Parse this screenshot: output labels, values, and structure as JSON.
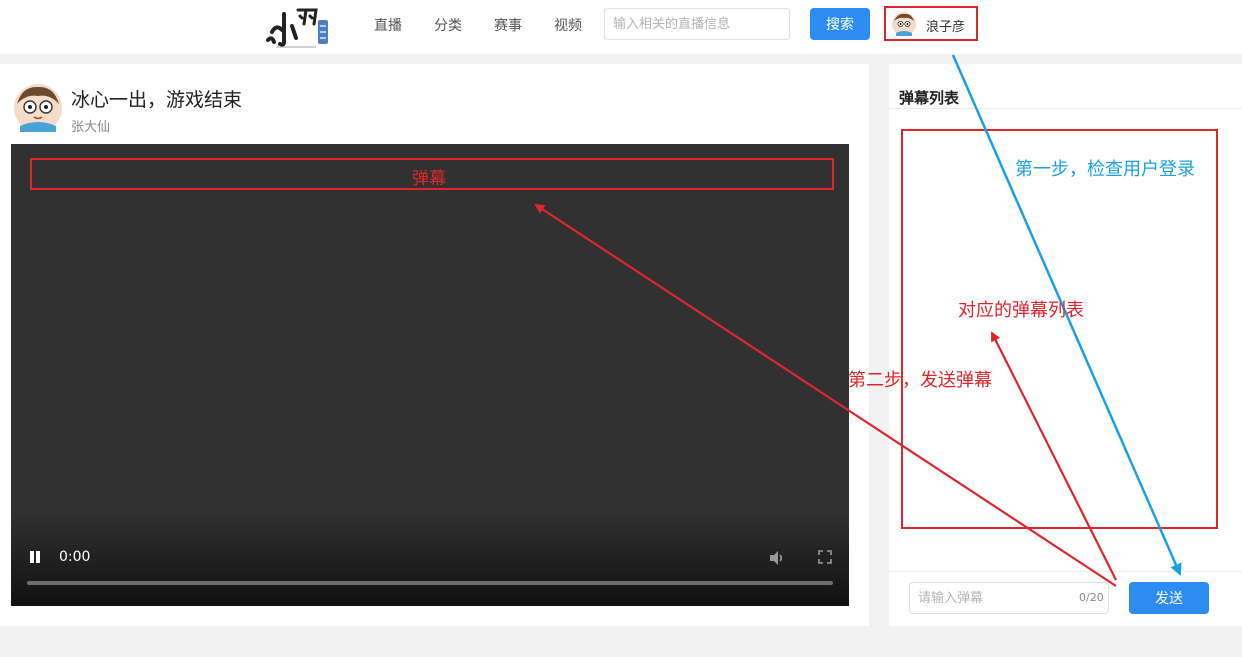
{
  "header": {
    "nav": [
      {
        "label": "直播"
      },
      {
        "label": "分类"
      },
      {
        "label": "赛事"
      },
      {
        "label": "视频"
      }
    ],
    "search_placeholder": "输入相关的直播信息",
    "search_button": "搜索",
    "username": "浪子彦"
  },
  "room": {
    "title": "冰心一出，游戏结束",
    "streamer": "张大仙"
  },
  "player": {
    "danmu_text": "弹幕",
    "current_time": "0:00",
    "state": "playing",
    "progress": 0
  },
  "sidebar": {
    "title": "弹幕列表",
    "input_placeholder": "请输入弹幕",
    "char_count": "0/20",
    "send_button": "发送"
  },
  "annotations": {
    "step1": "第一步，检查用户登录",
    "step2": "第二步，发送弹幕",
    "list_label": "对应的弹幕列表"
  },
  "colors": {
    "accent_blue": "#2d8cf0",
    "annotation_red": "#e0262b",
    "annotation_blue": "#1ba1e2",
    "video_bg": "#313131"
  }
}
